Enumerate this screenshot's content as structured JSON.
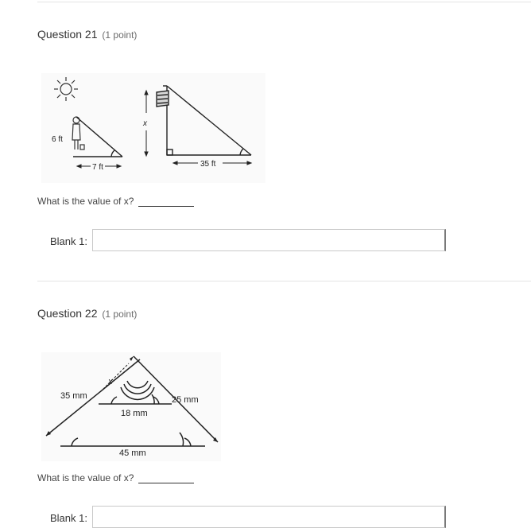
{
  "questions": [
    {
      "title": "Question 21",
      "points": "(1 point)",
      "prompt": "What is the value of x?",
      "blank_label": "Blank 1:",
      "blank_value": "",
      "figure": {
        "person_height": "6 ft",
        "person_shadow": "7 ft",
        "pole_height": "x",
        "pole_shadow": "35 ft"
      }
    },
    {
      "title": "Question 22",
      "points": "(1 point)",
      "prompt": "What is the value of x?",
      "blank_label": "Blank 1:",
      "blank_value": "",
      "figure": {
        "left_side": "35 mm",
        "top_segment": "x",
        "right_side": "25 mm",
        "inner_base": "18 mm",
        "outer_base": "45 mm"
      }
    }
  ]
}
